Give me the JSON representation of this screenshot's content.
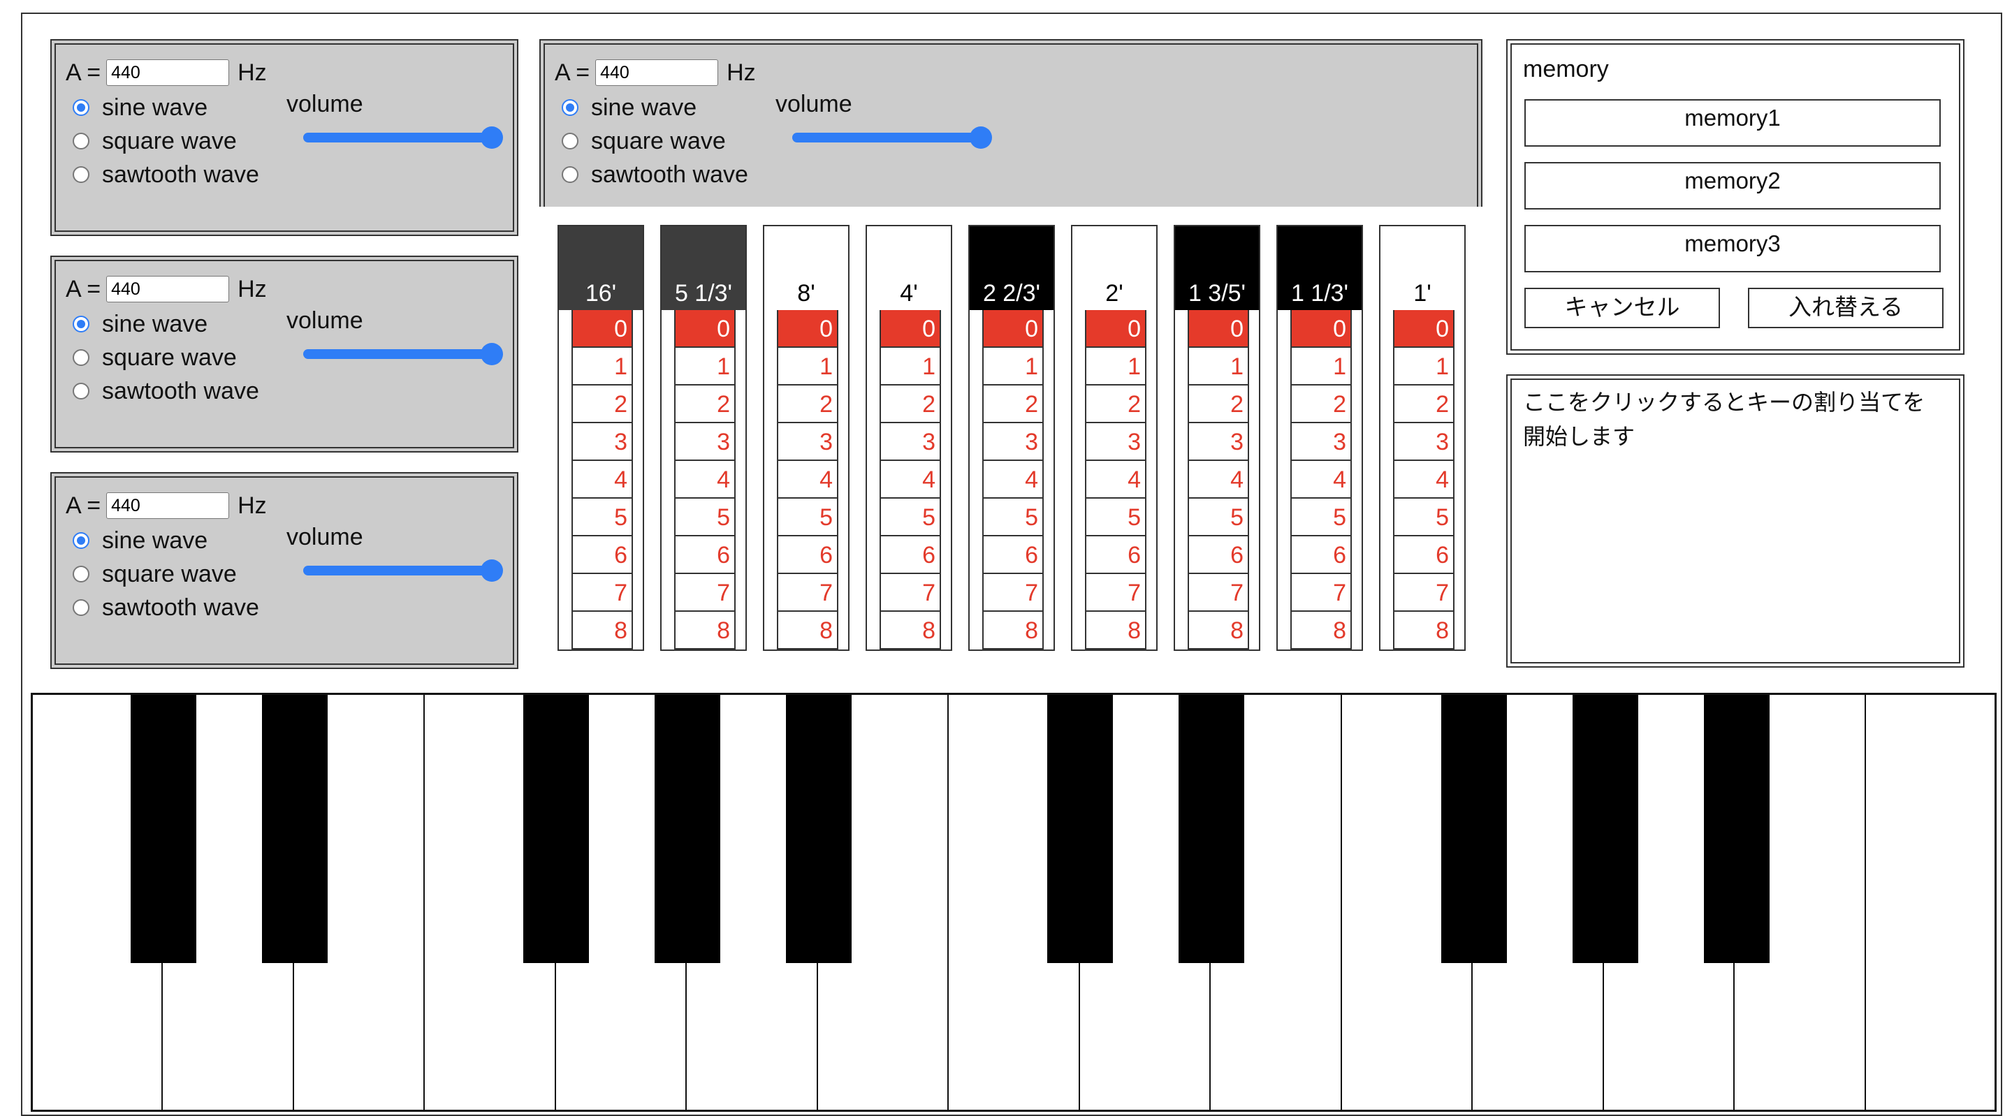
{
  "oscillators": [
    {
      "a_label": "A =",
      "freq": "440",
      "hz_label": "Hz",
      "waves": [
        "sine wave",
        "square wave",
        "sawtooth wave"
      ],
      "selected_wave": "sine wave",
      "volume_label": "volume",
      "volume_level": 1.0
    },
    {
      "a_label": "A =",
      "freq": "440",
      "hz_label": "Hz",
      "waves": [
        "sine wave",
        "square wave",
        "sawtooth wave"
      ],
      "selected_wave": "sine wave",
      "volume_label": "volume",
      "volume_level": 1.0
    },
    {
      "a_label": "A =",
      "freq": "440",
      "hz_label": "Hz",
      "waves": [
        "sine wave",
        "square wave",
        "sawtooth wave"
      ],
      "selected_wave": "sine wave",
      "volume_label": "volume",
      "volume_level": 1.0
    }
  ],
  "organ": {
    "a_label": "A =",
    "freq": "440",
    "hz_label": "Hz",
    "waves": [
      "sine wave",
      "square wave",
      "sawtooth wave"
    ],
    "selected_wave": "sine wave",
    "volume_label": "volume",
    "volume_level": 1.0,
    "steps": [
      "0",
      "1",
      "2",
      "3",
      "4",
      "5",
      "6",
      "7",
      "8"
    ],
    "drawbars": [
      {
        "label": "16'",
        "color": "gray",
        "value": "0"
      },
      {
        "label": "5 1/3'",
        "color": "gray",
        "value": "0"
      },
      {
        "label": "8'",
        "color": "white",
        "value": "0"
      },
      {
        "label": "4'",
        "color": "white",
        "value": "0"
      },
      {
        "label": "2 2/3'",
        "color": "black",
        "value": "0"
      },
      {
        "label": "2'",
        "color": "white",
        "value": "0"
      },
      {
        "label": "1 3/5'",
        "color": "black",
        "value": "0"
      },
      {
        "label": "1 1/3'",
        "color": "black",
        "value": "0"
      },
      {
        "label": "1'",
        "color": "white",
        "value": "0"
      }
    ]
  },
  "memory": {
    "title": "memory",
    "slots": [
      "memory1",
      "memory2",
      "memory3"
    ],
    "cancel_label": "キャンセル",
    "swap_label": "入れ替える"
  },
  "assign": {
    "text": "ここをクリックするとキーの割り当てを開始します"
  },
  "colors": {
    "accent": "#2f7df6",
    "drawbar_selected": "#e53a2a",
    "drawbar_numbers": "#e33a2b",
    "panel_gray": "#cccccc"
  }
}
